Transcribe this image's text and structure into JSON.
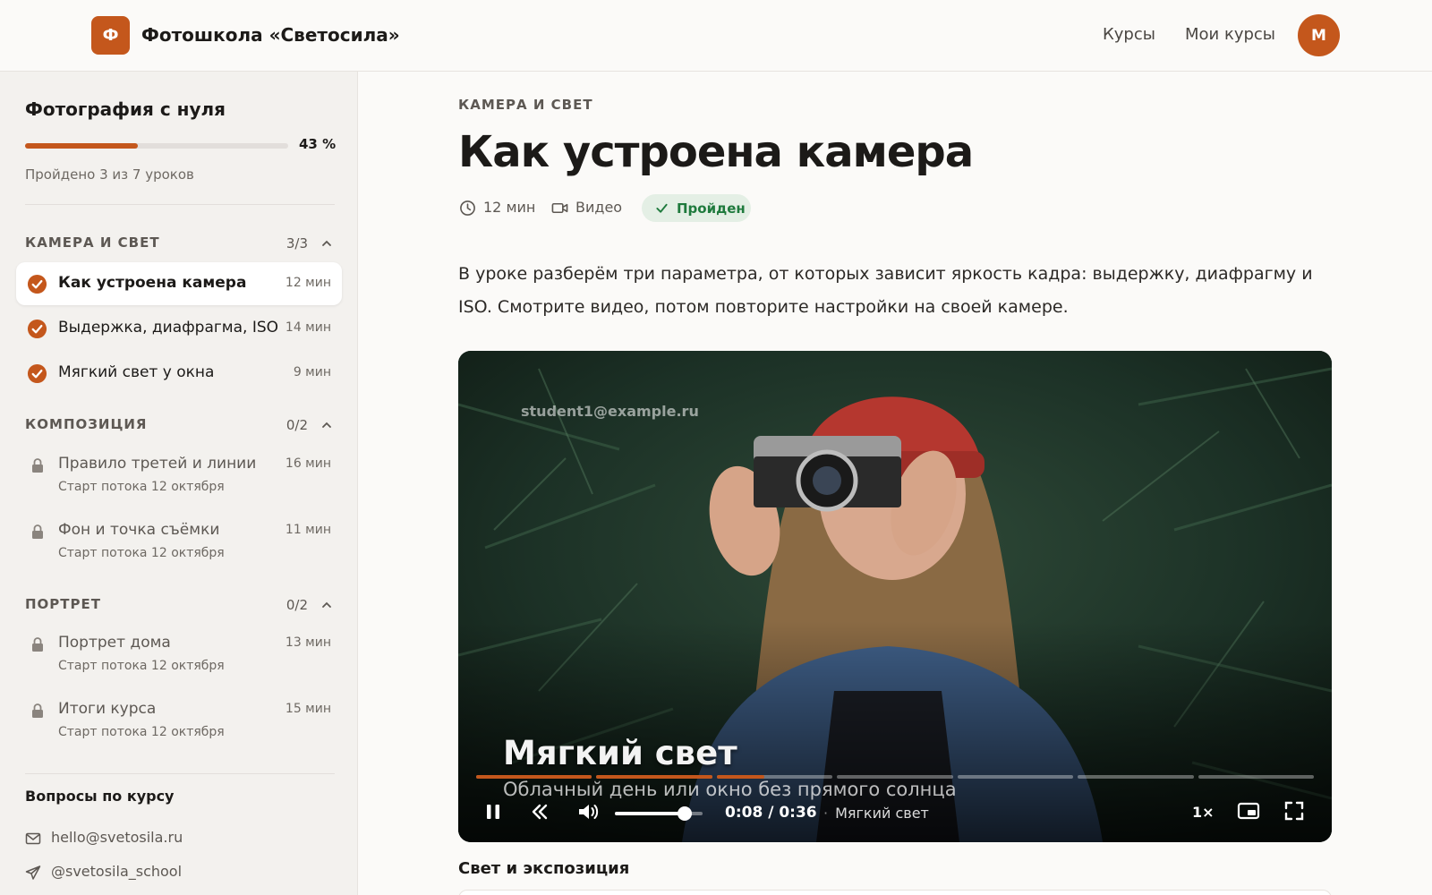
{
  "header": {
    "logo_letter": "Ф",
    "brand": "Фотошкола «Светосила»",
    "nav": [
      "Курсы",
      "Мои курсы"
    ],
    "avatar_letter": "М"
  },
  "sidebar": {
    "course_title": "Фотография с нуля",
    "progress_percent": 43,
    "progress_label": "43 %",
    "progress_text": "Пройдено 3 из 7 уроков",
    "sections": [
      {
        "title": "КАМЕРА И СВЕТ",
        "count": "3/3",
        "lessons": [
          {
            "title": "Как устроена камера",
            "duration": "12 мин",
            "status": "done",
            "active": true
          },
          {
            "title": "Выдержка, диафрагма, ISO",
            "duration": "14 мин",
            "status": "done"
          },
          {
            "title": "Мягкий свет у окна",
            "duration": "9 мин",
            "status": "done"
          }
        ]
      },
      {
        "title": "КОМПОЗИЦИЯ",
        "count": "0/2",
        "lessons": [
          {
            "title": "Правило третей и линии",
            "duration": "16 мин",
            "status": "locked",
            "note": "Старт потока 12 октября"
          },
          {
            "title": "Фон и точка съёмки",
            "duration": "11 мин",
            "status": "locked",
            "note": "Старт потока 12 октября"
          }
        ]
      },
      {
        "title": "ПОРТРЕТ",
        "count": "0/2",
        "lessons": [
          {
            "title": "Портрет дома",
            "duration": "13 мин",
            "status": "locked",
            "note": "Старт потока 12 октября"
          },
          {
            "title": "Итоги курса",
            "duration": "15 мин",
            "status": "locked",
            "note": "Старт потока 12 октября"
          }
        ]
      }
    ],
    "support": {
      "title": "Вопросы по курсу",
      "email": "hello@svetosila.ru",
      "telegram": "@svetosila_school"
    }
  },
  "lesson": {
    "section": "КАМЕРА И СВЕТ",
    "title": "Как устроена камера",
    "duration": "12 мин",
    "type": "Видео",
    "status": "Пройден",
    "description": "В уроке разберём три параметра, от которых зависит яркость кадра: выдержку, диафрагму и ISO. Смотрите видео, потом повторите настройки на своей камере."
  },
  "player": {
    "watermark": "student1@example.ru",
    "caption_title": "Мягкий свет",
    "caption_subtitle": "Облачный день или окно без прямого солнца",
    "chapter_fill": [
      1,
      1,
      0.41,
      0,
      0,
      0,
      0
    ],
    "volume": 0.8,
    "current_time": "0:08",
    "total_time": "0:36",
    "chapter": "Мягкий свет",
    "speed": "1×"
  },
  "below_video": {
    "section_title": "Свет и экспозиция"
  },
  "colors": {
    "accent": "#c4571c",
    "success_bg": "#e4efe5",
    "success_text": "#1f7a3d"
  }
}
